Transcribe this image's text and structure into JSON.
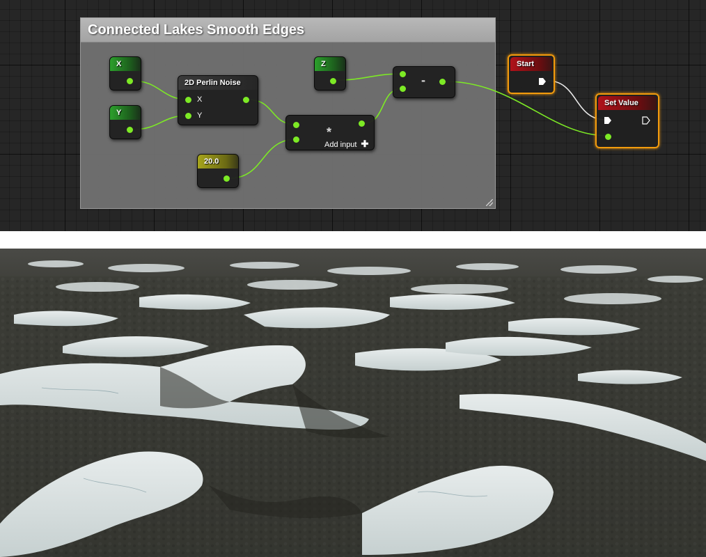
{
  "graph": {
    "comment_title": "Connected Lakes Smooth Edges",
    "nodes": {
      "x": {
        "title": "X"
      },
      "y": {
        "title": "Y"
      },
      "perlin": {
        "title": "2D Perlin Noise",
        "pins": [
          "X",
          "Y"
        ]
      },
      "z": {
        "title": "Z"
      },
      "constant": {
        "title": "20.0"
      },
      "multiply": {
        "op": "*",
        "add_input": "Add input"
      },
      "subtract": {
        "op": "-"
      },
      "start": {
        "title": "Start"
      },
      "set_value": {
        "title": "Set Value"
      }
    },
    "colors": {
      "wire": "#7dea25",
      "exec_wire": "#e0e0e0",
      "selection": "#f39b0d"
    }
  },
  "render": {
    "description_icon": "terrain-render",
    "colors": {
      "rock": "#3a3b35",
      "ice": "#dfe6e6"
    }
  }
}
